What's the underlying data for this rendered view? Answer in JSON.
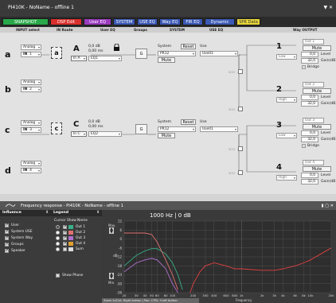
{
  "window": {
    "title": "PI410K - NoName - offline 1",
    "controls": "▼ ✕"
  },
  "tabs": [
    {
      "label": "SNAPSHOT",
      "color": "#29a84a"
    },
    {
      "label": "DSP Edit",
      "color": "#d9302e"
    },
    {
      "label": "User EQ",
      "color": "#9b3cbf"
    },
    {
      "label": "SYSTEM",
      "color": "#3b59b5"
    },
    {
      "label": "USE EQ",
      "color": "#3b59b5"
    },
    {
      "label": "Way EQ",
      "color": "#3b59b5"
    },
    {
      "label": "FIR EQ",
      "color": "#3b59b5"
    },
    {
      "label": "Dynamic",
      "color": "#3b59b5"
    },
    {
      "label": "SPK Data",
      "color": "#e7d43a"
    }
  ],
  "columns": {
    "input_select": "INPUT select",
    "in_route": "IN Route",
    "user_eq": "User EQ",
    "groups": "Groups",
    "system": "SYSTEM",
    "use_eq": "USE EQ",
    "way_output": "Way OUTPUT"
  },
  "inputs": [
    {
      "letter": "a",
      "type": "Analog",
      "in": "IN",
      "ch": "1"
    },
    {
      "letter": "b",
      "type": "Analog",
      "in": "IN",
      "ch": "2"
    },
    {
      "letter": "c",
      "type": "Analog",
      "in": "IN",
      "ch": "3"
    },
    {
      "letter": "d",
      "type": "Analog",
      "in": "IN",
      "ch": "4"
    }
  ],
  "routes": [
    {
      "left": "a",
      "right": "A",
      "gain": "0,0 dB",
      "delay": "0,00 ms",
      "tag": "In A",
      "eq": "EQ1",
      "locked": true
    },
    {
      "left": "c",
      "right": "C",
      "gain": "0,0 dB",
      "delay": "0,00 ms",
      "tag": "In C",
      "eq": "EQ2",
      "locked": false
    }
  ],
  "groups": [
    {
      "label": "G"
    },
    {
      "label": "G"
    }
  ],
  "systems": [
    {
      "label": "System",
      "reset": "Reset",
      "value": "PR12",
      "mute": "Mute",
      "use": "Use",
      "use_value": "Use01"
    },
    {
      "label": "System",
      "reset": "Reset",
      "value": "PR12",
      "mute": "Mute",
      "use": "Use",
      "use_value": "Use01"
    }
  ],
  "xover": [
    "2CO",
    "2CO",
    "2CO",
    "2CO"
  ],
  "outputs": [
    {
      "num": "1",
      "name": "Out 1",
      "mute": "Mute",
      "way": "Low",
      "level": "0,0",
      "level_label": "Level",
      "gain": "32,0",
      "gain_label": "Gain(dB)",
      "bridge": "Bridge"
    },
    {
      "num": "2",
      "name": "Out 2",
      "mute": "Mute",
      "way": "High",
      "level": "0,0",
      "level_label": "Level",
      "gain": "32,0",
      "gain_label": "Gain(dB)",
      "bridge": ""
    },
    {
      "num": "3",
      "name": "Out 3",
      "mute": "Mute",
      "way": "Low",
      "level": "0,0",
      "level_label": "Level",
      "gain": "32,0",
      "gain_label": "Gain(dB)",
      "bridge": "Bridge"
    },
    {
      "num": "4",
      "name": "Out 4",
      "mute": "Mute",
      "way": "High",
      "level": "0,0",
      "level_label": "Level",
      "gain": "32,0",
      "gain_label": "Gain(dB)",
      "bridge": ""
    }
  ],
  "freq": {
    "title": "Frequency response - PI410K - NoName - offline 1",
    "header_controls": "▮ ▢ ✕",
    "influence_title": "Influence",
    "influence": [
      {
        "label": "User",
        "checked": true
      },
      {
        "label": "System USE",
        "checked": true
      },
      {
        "label": "System Way",
        "checked": true
      },
      {
        "label": "Groups",
        "checked": true
      },
      {
        "label": "Speaker",
        "checked": true
      }
    ],
    "legend_title": "Legend",
    "legend_cols": {
      "cursor": "Cursor",
      "show": "Show",
      "name": "Name"
    },
    "legend": [
      {
        "name": "Out 1",
        "color": "#38b08a",
        "cursor": true,
        "show": true
      },
      {
        "name": "Out 2",
        "color": "#e07070",
        "cursor": false,
        "show": true
      },
      {
        "name": "Out 3",
        "color": "#b070d0",
        "cursor": false,
        "show": true
      },
      {
        "name": "Out 4",
        "color": "#e0a030",
        "cursor": false,
        "show": true
      },
      {
        "name": "Sum",
        "color": "#dddddd",
        "cursor": false,
        "show": false
      }
    ],
    "show_phase": "Show Phase",
    "readout": "1000 Hz | 0 dB",
    "max_label": "Max.",
    "min_label": "Min.",
    "db_label": "dB",
    "y_ticks": [
      "12",
      "6",
      "0",
      "-6",
      "-12",
      "-18",
      "-24",
      "-30",
      "-36"
    ],
    "x_ticks": [
      "20",
      "30",
      "40",
      "50",
      "60",
      "80",
      "100",
      "200",
      "300",
      "400",
      "600",
      "800",
      "1k",
      "2k",
      "3k",
      "4k",
      "6k",
      "8k",
      "10k",
      "20k"
    ],
    "x_label": "Frequency",
    "footer": "Zoom In/Out: Right button | Pan: CTRL +Left button"
  },
  "chart_data": {
    "type": "line",
    "title": "1000 Hz | 0 dB",
    "xlabel": "Frequency",
    "ylabel": "dB",
    "x_scale": "log",
    "xlim": [
      20,
      20000
    ],
    "ylim": [
      -36,
      12
    ],
    "series": [
      {
        "name": "Out 1",
        "color": "#38b08a",
        "points": [
          [
            20,
            -18
          ],
          [
            30,
            -11
          ],
          [
            40,
            -8
          ],
          [
            50,
            -6.5
          ],
          [
            60,
            -6.5
          ],
          [
            80,
            -10
          ],
          [
            100,
            -16
          ],
          [
            120,
            -24
          ],
          [
            140,
            -34
          ]
        ]
      },
      {
        "name": "Out 2",
        "color": "#e07070",
        "points": [
          [
            20,
            4
          ],
          [
            30,
            4
          ],
          [
            40,
            4
          ],
          [
            50,
            3
          ],
          [
            60,
            -2
          ],
          [
            80,
            -14
          ],
          [
            100,
            -24
          ],
          [
            120,
            -34
          ]
        ]
      },
      {
        "name": "Out 3",
        "color": "#b070d0",
        "points": [
          [
            20,
            -22
          ],
          [
            30,
            -16
          ],
          [
            40,
            -14
          ],
          [
            50,
            -13
          ],
          [
            60,
            -14
          ],
          [
            80,
            -20
          ],
          [
            100,
            -30
          ],
          [
            120,
            -36
          ]
        ]
      },
      {
        "name": "Out 4",
        "color": "#e04040",
        "points": [
          [
            180,
            -36
          ],
          [
            200,
            -30
          ],
          [
            250,
            -22
          ],
          [
            300,
            -18
          ],
          [
            400,
            -16
          ],
          [
            600,
            -18
          ],
          [
            800,
            -20
          ],
          [
            1000,
            -20
          ],
          [
            2000,
            -21
          ],
          [
            3000,
            -21
          ],
          [
            4000,
            -20
          ],
          [
            6000,
            -18
          ],
          [
            8000,
            -16
          ],
          [
            10000,
            -14
          ],
          [
            20000,
            -6
          ]
        ]
      }
    ]
  }
}
